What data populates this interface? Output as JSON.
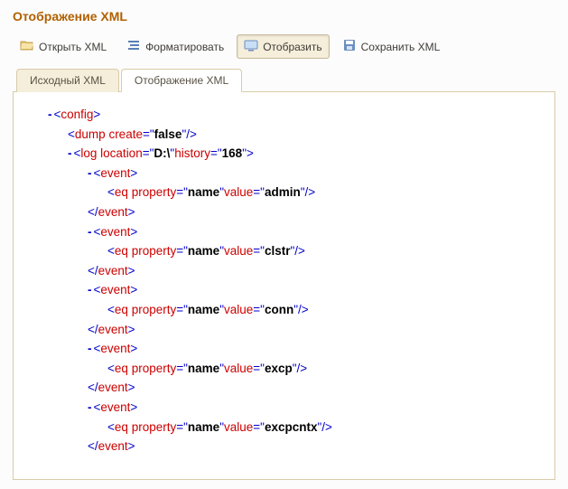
{
  "title": "Отображение XML",
  "toolbar": {
    "open": "Открыть XML",
    "format": "Форматировать",
    "display": "Отобразить",
    "save": "Сохранить XML"
  },
  "tabs": {
    "source": "Исходный XML",
    "display": "Отображение XML"
  },
  "xml": {
    "config": "config",
    "dump": "dump",
    "dump_attr": "create",
    "dump_val": "false",
    "log": "log",
    "log_loc_attr": "location",
    "log_loc_val": "D:\\",
    "log_hist_attr": "history",
    "log_hist_val": "168",
    "event": "event",
    "eq": "eq",
    "prop_attr": "property",
    "prop_val": "name",
    "value_attr": "value",
    "values": {
      "v0": "admin",
      "v1": "clstr",
      "v2": "conn",
      "v3": "excp",
      "v4": "excpcntx"
    }
  },
  "chart_data": {
    "type": "table",
    "note": "XML tree viewer showing config/log/events with eq property=name values.",
    "series": [
      {
        "name": "eq.value",
        "values": [
          "admin",
          "clstr",
          "conn",
          "excp",
          "excpcntx"
        ]
      }
    ]
  }
}
